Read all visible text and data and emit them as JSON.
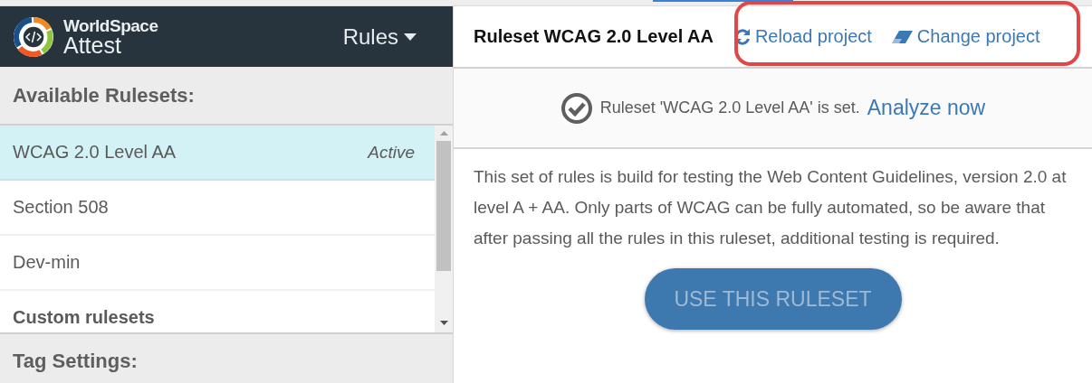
{
  "app": {
    "logo_top": "WorldSpace",
    "logo_bottom": "Attest",
    "menu": "Rules"
  },
  "sidebar": {
    "heading": "Available Rulesets:",
    "rulesets": [
      {
        "label": "WCAG 2.0 Level AA",
        "badge": "Active",
        "selected": true,
        "kind": "plain"
      },
      {
        "label": "Section 508",
        "selected": false,
        "kind": "plain"
      },
      {
        "label": "Dev-min",
        "selected": false,
        "kind": "plain"
      },
      {
        "label": "Custom rulesets",
        "selected": false,
        "kind": "group"
      }
    ],
    "footer_heading": "Tag Settings:"
  },
  "main": {
    "title": "Ruleset WCAG 2.0 Level AA",
    "links": [
      {
        "label": "Reload project",
        "kind": "reload"
      },
      {
        "label": "Change project",
        "kind": "eraser"
      }
    ],
    "highlighted": true,
    "status": {
      "message": "Ruleset 'WCAG 2.0 Level AA' is set.",
      "link": "Analyze now"
    },
    "description": "This set of rules is build for testing the Web Content Guidelines, version 2.0 at level A + AA. Only parts of WCAG can be fully automated, so be aware that after passing all the rules in this ruleset, additional testing is required.",
    "button": {
      "label": "USE THIS RULESET",
      "disabled": true
    }
  }
}
